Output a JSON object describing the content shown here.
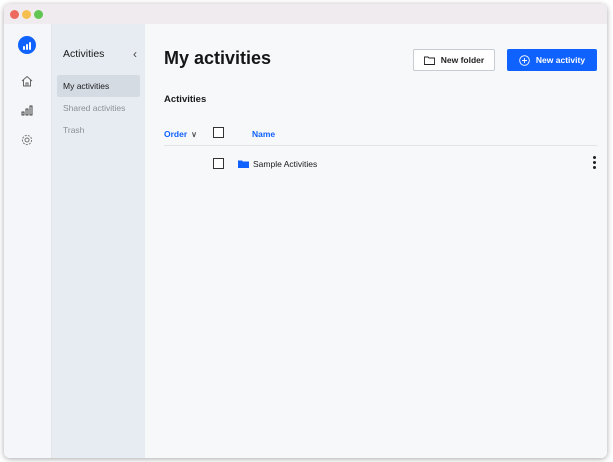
{
  "colors": {
    "accent": "#0f62fe",
    "sidebar_bg": "#e7ecf2",
    "main_bg": "#f7f8fa"
  },
  "rail": {
    "icons": [
      "app-logo-icon",
      "home-icon",
      "activities-chart-icon",
      "settings-gear-icon"
    ]
  },
  "sidebar": {
    "title": "Activities",
    "collapse_icon": "chevron-left-icon",
    "items": [
      {
        "label": "My activities",
        "active": true
      },
      {
        "label": "Shared activities",
        "active": false
      },
      {
        "label": "Trash",
        "active": false
      }
    ]
  },
  "main": {
    "title": "My activities",
    "new_folder_label": "New folder",
    "new_activity_label": "New activity",
    "section_label": "Activities",
    "columns": {
      "order": "Order",
      "name": "Name"
    },
    "rows": [
      {
        "name": "Sample Activities",
        "type": "folder"
      }
    ]
  }
}
